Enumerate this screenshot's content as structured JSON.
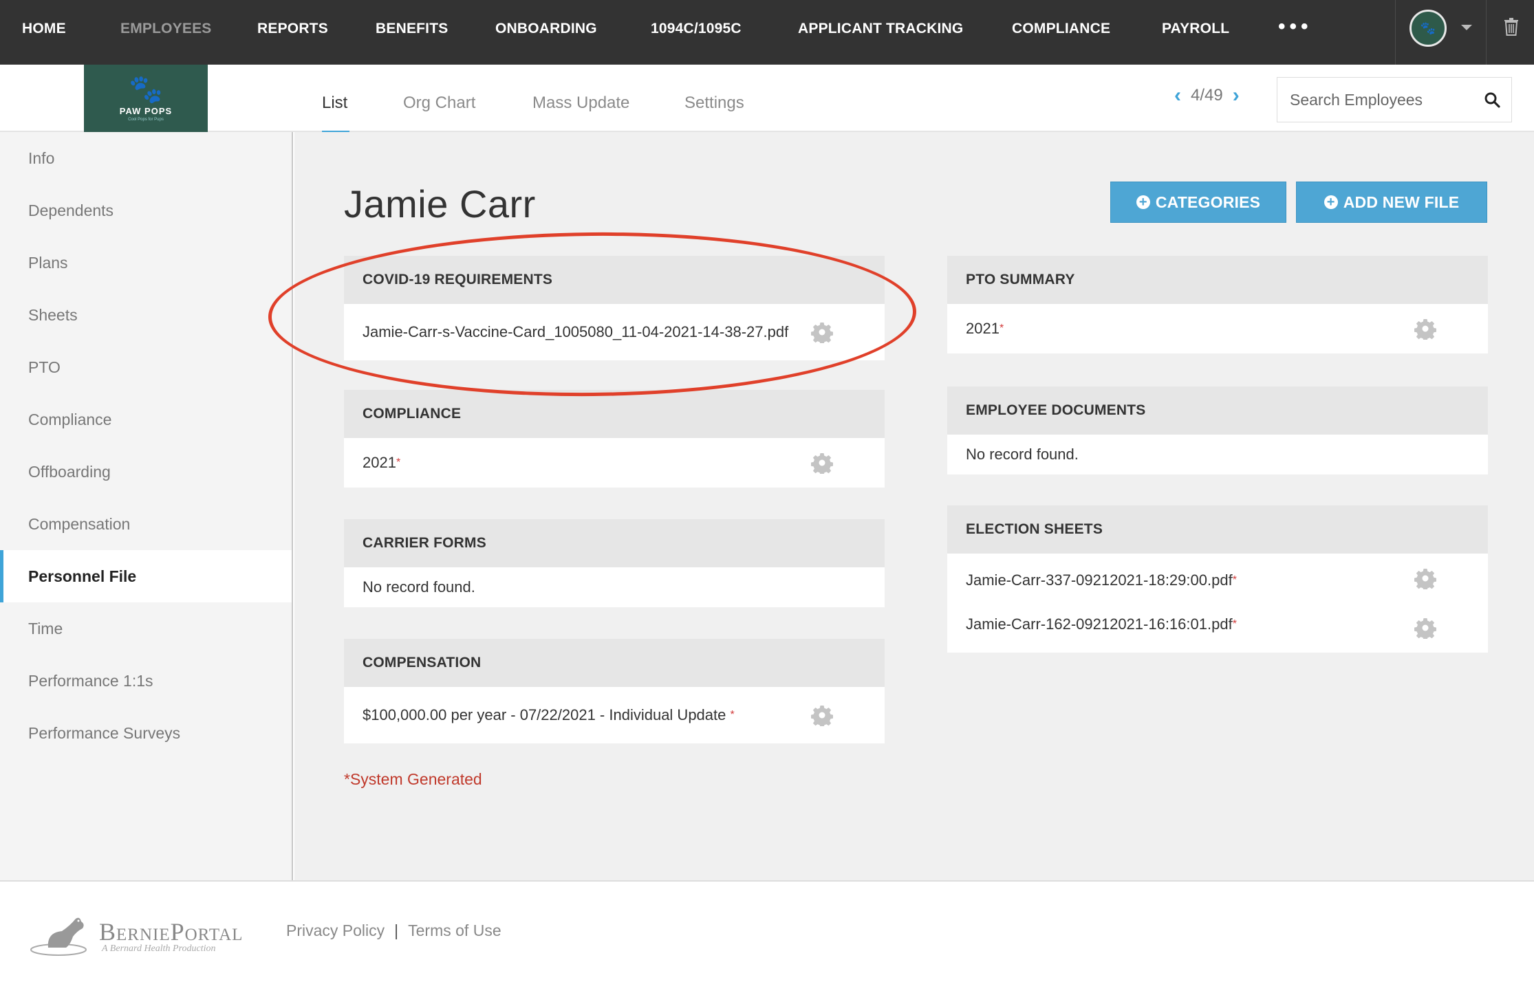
{
  "topnav": {
    "items": [
      {
        "label": "HOME",
        "active": false
      },
      {
        "label": "EMPLOYEES",
        "active": true
      },
      {
        "label": "REPORTS",
        "active": false
      },
      {
        "label": "BENEFITS",
        "active": false
      },
      {
        "label": "ONBOARDING",
        "active": false
      },
      {
        "label": "1094C/1095C",
        "active": false
      },
      {
        "label": "APPLICANT TRACKING",
        "active": false
      },
      {
        "label": "COMPLIANCE",
        "active": false
      },
      {
        "label": "PAYROLL",
        "active": false
      }
    ],
    "more_label": "•••",
    "avatar_icon": "paw-icon",
    "avatar_glyph": "🐾"
  },
  "logo": {
    "name": "PAW POPS",
    "tagline": "Cool Pops for Pups",
    "glyph": "🐾"
  },
  "subtabs": [
    {
      "label": "List",
      "active": true
    },
    {
      "label": "Org Chart",
      "active": false
    },
    {
      "label": "Mass Update",
      "active": false
    },
    {
      "label": "Settings",
      "active": false
    }
  ],
  "pager": {
    "prev": "‹",
    "text": "4/49",
    "next": "›"
  },
  "search": {
    "placeholder": "Search Employees",
    "value": ""
  },
  "sidebar": {
    "items": [
      {
        "label": "Info",
        "active": false
      },
      {
        "label": "Dependents",
        "active": false
      },
      {
        "label": "Plans",
        "active": false
      },
      {
        "label": "Sheets",
        "active": false
      },
      {
        "label": "PTO",
        "active": false
      },
      {
        "label": "Compliance",
        "active": false
      },
      {
        "label": "Offboarding",
        "active": false
      },
      {
        "label": "Compensation",
        "active": false
      },
      {
        "label": "Personnel File",
        "active": true
      },
      {
        "label": "Time",
        "active": false
      },
      {
        "label": "Performance 1:1s",
        "active": false
      },
      {
        "label": "Performance Surveys",
        "active": false
      }
    ]
  },
  "main": {
    "employee_name": "Jamie Carr",
    "buttons": {
      "categories": "CATEGORIES",
      "add_new_file": "ADD NEW FILE"
    },
    "left_sections": [
      {
        "title": "COVID-19 REQUIREMENTS",
        "rows": [
          {
            "text": "Jamie-Carr-s-Vaccine-Card_1005080_11-04-2021-14-38-27.pdf",
            "system": false,
            "gear": true
          }
        ]
      },
      {
        "title": "COMPLIANCE",
        "rows": [
          {
            "text": "2021",
            "system": true,
            "gear": true
          }
        ]
      },
      {
        "title": "CARRIER FORMS",
        "rows": [
          {
            "text": "No record found.",
            "system": false,
            "gear": false
          }
        ]
      },
      {
        "title": "COMPENSATION",
        "rows": [
          {
            "text": "$100,000.00 per year - 07/22/2021 - Individual Update",
            "system": true,
            "gear": true
          }
        ]
      }
    ],
    "right_sections": [
      {
        "title": "PTO SUMMARY",
        "rows": [
          {
            "text": "2021",
            "system": true,
            "gear": true
          }
        ]
      },
      {
        "title": "EMPLOYEE DOCUMENTS",
        "rows": [
          {
            "text": "No record found.",
            "system": false,
            "gear": false
          }
        ]
      },
      {
        "title": "ELECTION SHEETS",
        "rows": [
          {
            "text": "Jamie-Carr-337-09212021-18:29:00.pdf",
            "system": true,
            "gear": true
          },
          {
            "text": "Jamie-Carr-162-09212021-16:16:01.pdf",
            "system": true,
            "gear": true
          }
        ]
      }
    ],
    "system_generated_note": "*System Generated",
    "star": "*"
  },
  "footer": {
    "brand_name": "BerniePortal",
    "brand_sub": "A Bernard Health Production",
    "links": [
      "Privacy Policy",
      "Terms of Use"
    ],
    "separator": "|"
  },
  "colors": {
    "accent": "#3fa4d8",
    "button": "#4ea6d4",
    "nav_bg": "#333333",
    "logo_bg": "#2f5a4e",
    "required_star": "#d23b3b",
    "annotation_ellipse": "#e0402a"
  }
}
